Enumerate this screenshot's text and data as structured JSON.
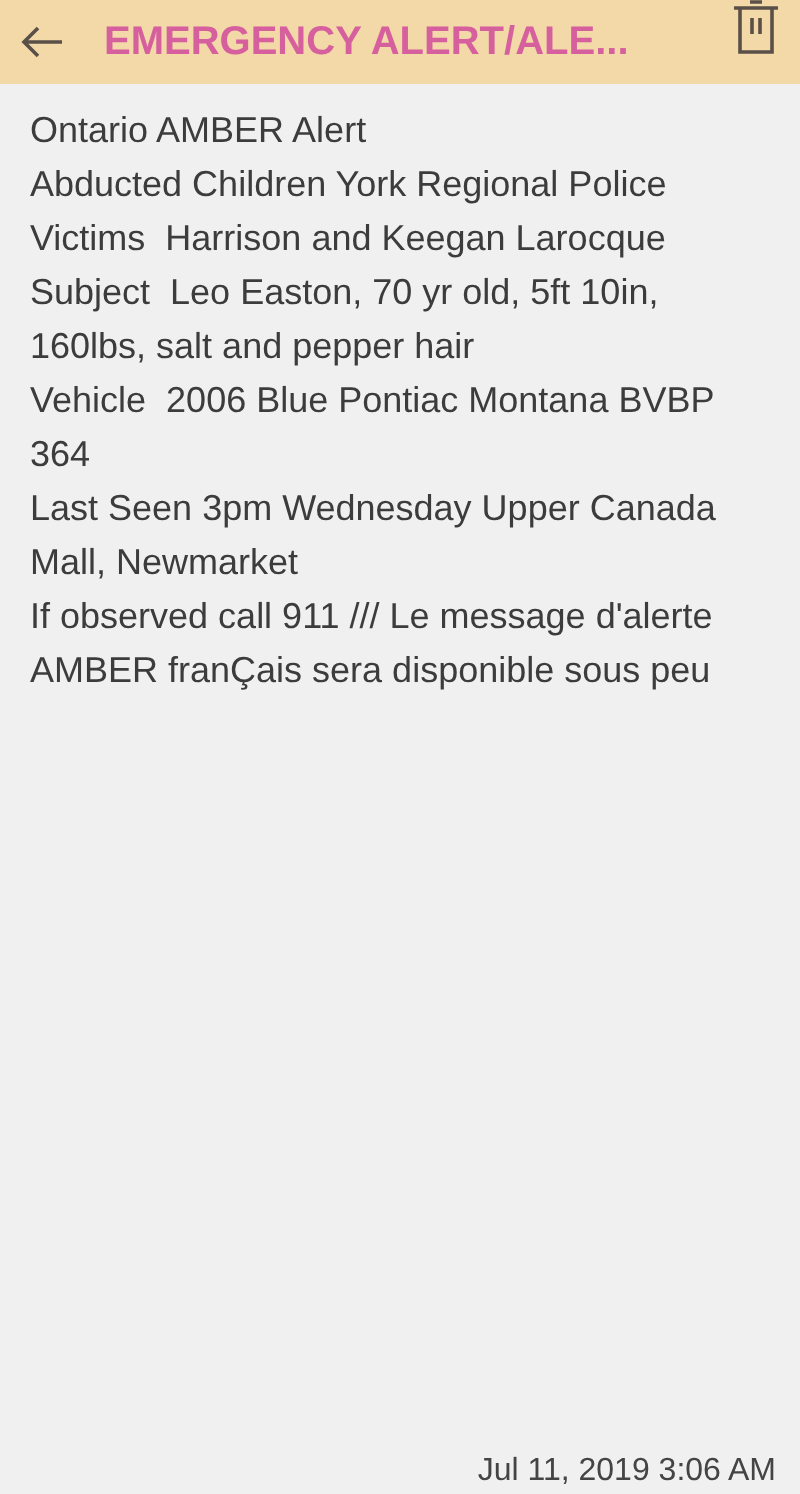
{
  "header": {
    "title": "EMERGENCY ALERT/ALE..."
  },
  "message": [
    "Ontario AMBER Alert",
    "Abducted Children York Regional Police",
    "Victims  Harrison and Keegan Larocque",
    "Subject  Leo Easton, 70 yr old, 5ft 10in, 160lbs, salt and pepper hair",
    "Vehicle  2006 Blue Pontiac Montana BVBP 364",
    "Last Seen 3pm Wednesday Upper Canada Mall, Newmarket",
    "If observed call 911 /// Le message d'alerte AMBER franÇais sera disponible sous peu"
  ],
  "timestamp": "Jul 11, 2019 3:06 AM"
}
